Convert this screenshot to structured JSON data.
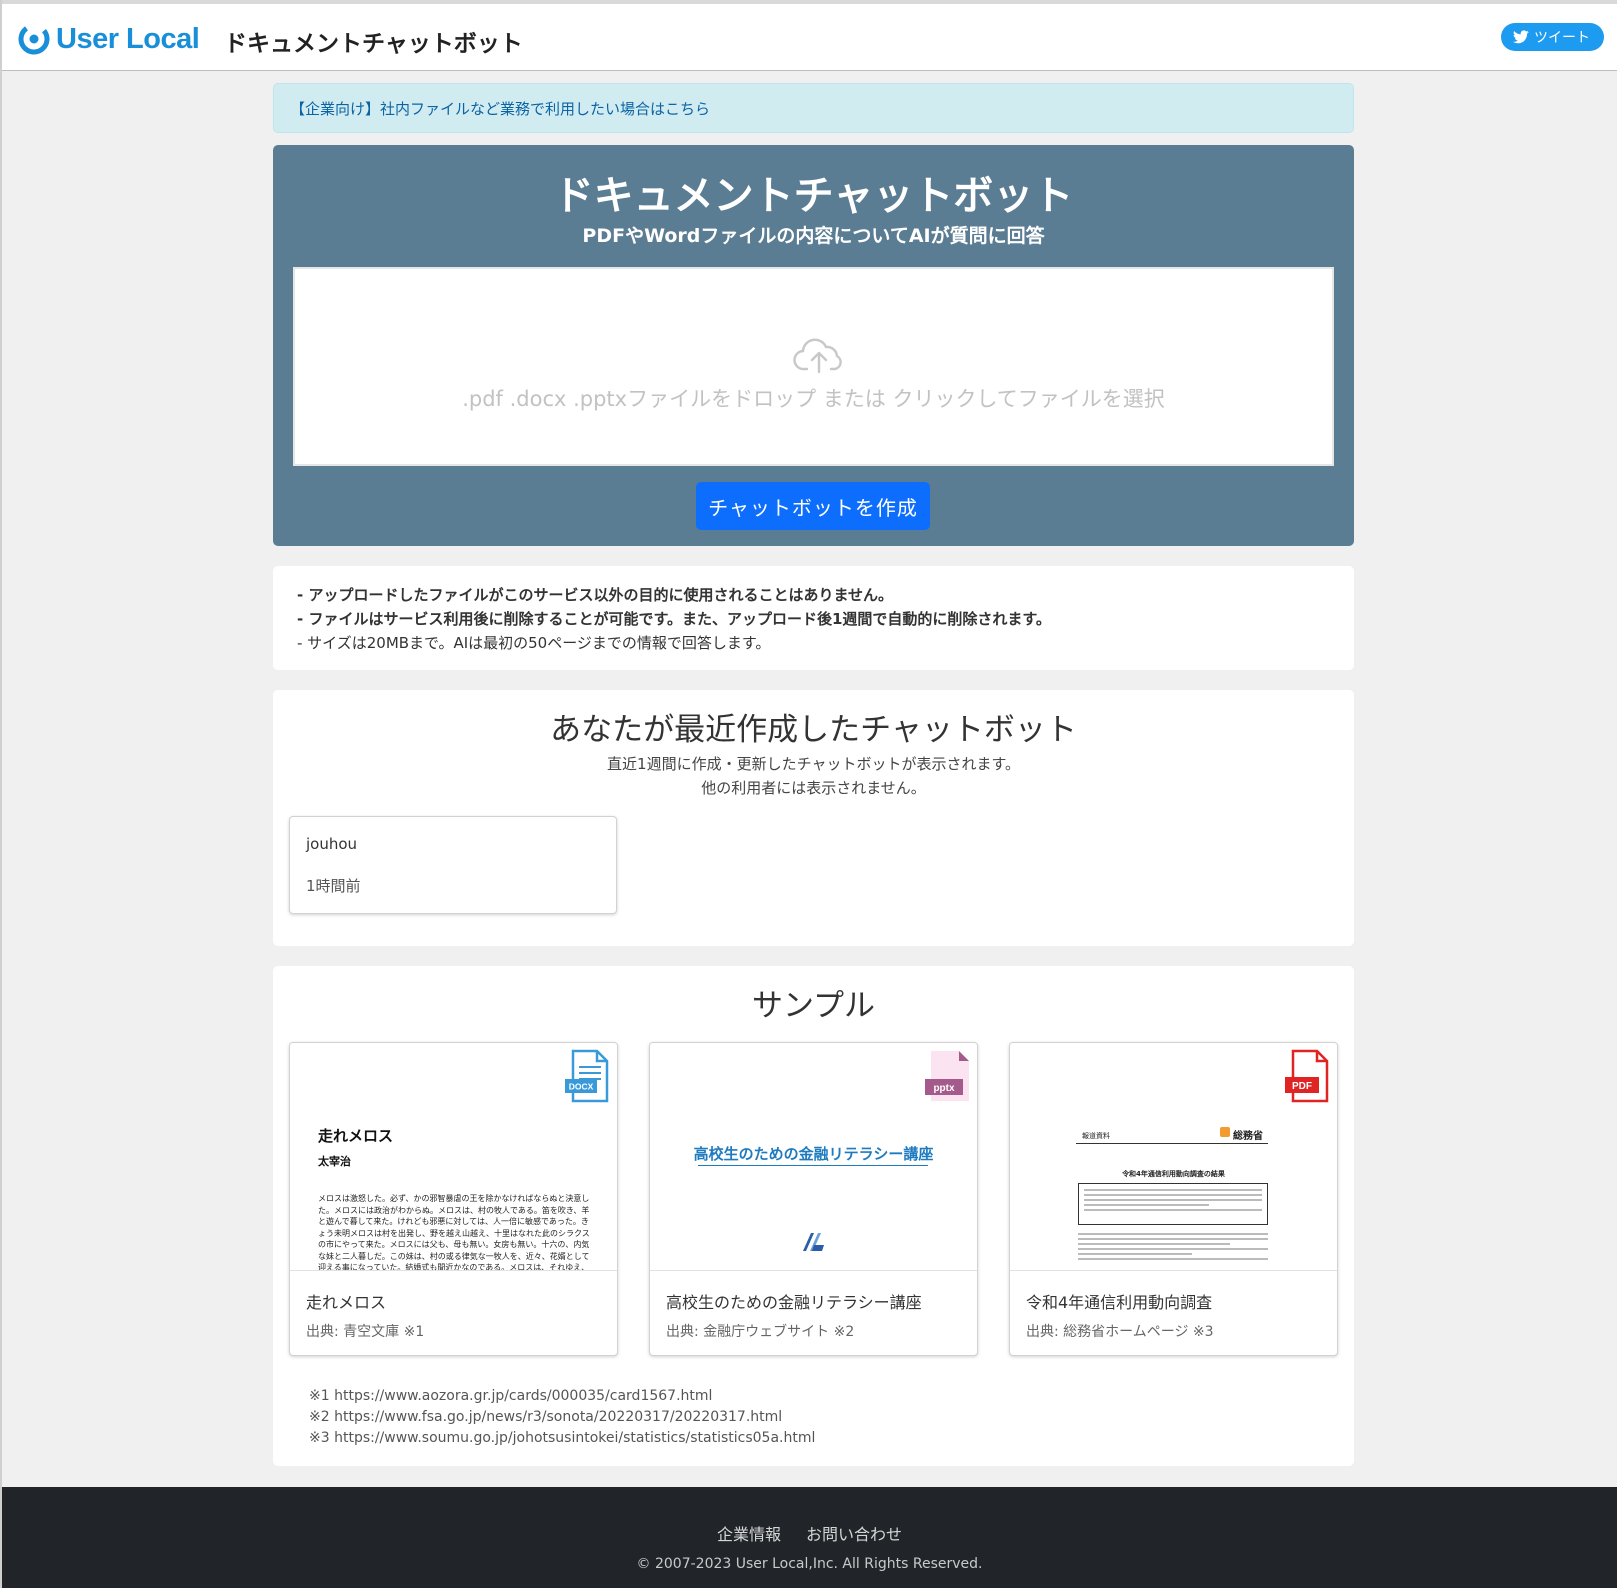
{
  "header": {
    "logo_text": "User Local",
    "title": "ドキュメントチャットボット",
    "tweet_label": "ツイート"
  },
  "alert": {
    "text": "【企業向け】社内ファイルなど業務で利用したい場合はこちら"
  },
  "hero": {
    "title": "ドキュメントチャットボット",
    "subtitle": "PDFやWordファイルの内容についてAIが質問に回答",
    "drop_text": ".pdf .docx .pptxファイルをドロップ または クリックしてファイルを選択",
    "create_button": "チャットボットを作成"
  },
  "notes": [
    "- アップロードしたファイルがこのサービス以外の目的に使用されることはありません。",
    "- ファイルはサービス利用後に削除することが可能です。また、アップロード後1週間で自動的に削除されます。",
    "- サイズは20MBまで。AIは最初の50ページまでの情報で回答します。"
  ],
  "recent": {
    "title": "あなたが最近作成したチャットボット",
    "desc1": "直近1週間に作成・更新したチャットボットが表示されます。",
    "desc2": "他の利用者には表示されません。",
    "bots": [
      {
        "name": "jouhou",
        "time": "1時間前"
      }
    ]
  },
  "samples": {
    "title": "サンプル",
    "cards": [
      {
        "title": "走れメロス",
        "source": "出典: 青空文庫 ※1",
        "file_type": "DOCX",
        "thumb_title": "走れメロス",
        "thumb_author": "太宰治",
        "thumb_body": "メロスは激怒した。必ず、かの邪智暴虐の王を除かなければならぬと決意した。メロスには政治がわからぬ。メロスは、村の牧人である。笛を吹き、羊と遊んで暮して来た。けれども邪悪に対しては、人一倍に敏感であった。きょう未明メロスは村を出発し、野を越え山越え、十里はなれた此のシラクスの市にやって来た。メロスには父も、母も無い。女房も無い。十六の、内気な妹と二人暮しだ。この妹は、村の或る律気な一牧人を、近々、花婿として迎える事になっていた。結婚式も間近かなのである。メロスは、それゆえ、花"
      },
      {
        "title": "高校生のための金融リテラシー講座",
        "source": "出典: 金融庁ウェブサイト ※2",
        "file_type": "pptx",
        "thumb_title": "高校生のための金融リテラシー講座"
      },
      {
        "title": "令和4年通信利用動向調査",
        "source": "出典: 総務省ホームページ ※3",
        "file_type": "PDF",
        "thumb_label": "報道資料",
        "thumb_org": "総務省",
        "thumb_heading": "令和4年通信利用動向調査の結果"
      }
    ]
  },
  "refs": [
    "※1 https://www.aozora.gr.jp/cards/000035/card1567.html",
    "※2 https://www.fsa.go.jp/news/r3/sonota/20220317/20220317.html",
    "※3 https://www.soumu.go.jp/johotsusintokei/statistics/statistics05a.html"
  ],
  "footer": {
    "link_company": "企業情報",
    "link_contact": "お問い合わせ",
    "copyright": "© 2007-2023 User Local,Inc. All Rights Reserved."
  },
  "colors": {
    "brand": "#1a8fd9",
    "hero_bg": "#5b7d93",
    "primary_button": "#0d6efd",
    "alert_bg": "#d1ecf1",
    "footer_bg": "#212529"
  }
}
